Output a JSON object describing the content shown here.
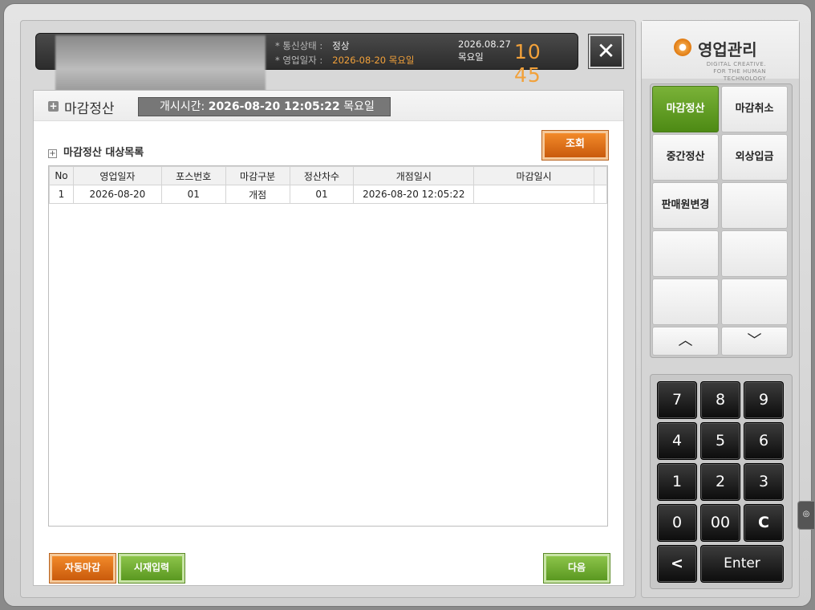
{
  "header": {
    "status_label_1": "* 통신상태 :",
    "status_value_1": "정상",
    "status_label_2": "* 영업일자 :",
    "status_value_2": "2026-08-20 목요일",
    "date": "2026.08.27",
    "weekday": "목요일",
    "clock_hour": "10",
    "clock_min": "45",
    "close_icon": "close-icon"
  },
  "page": {
    "title": "마감정산",
    "open_time_label": "개시시간:",
    "open_time_value": "2026-08-20 12:05:22",
    "open_time_day": "목요일",
    "section_title": "마감정산 대상목록",
    "query_button": "조회"
  },
  "table": {
    "columns": [
      "No",
      "영업일자",
      "포스번호",
      "마감구분",
      "정산차수",
      "개점일시",
      "마감일시"
    ],
    "rows": [
      [
        "1",
        "2026-08-20",
        "01",
        "개점",
        "01",
        "2026-08-20 12:05:22",
        ""
      ]
    ]
  },
  "footer": {
    "auto_close": "자동마감",
    "cash_input": "시재입력",
    "next": "다음"
  },
  "right": {
    "logo_text": "영업관리",
    "logo_sub_1": "DIGITAL CREATIVE.",
    "logo_sub_2": "FOR THE HUMAN TECHNOLOGY",
    "menu": [
      "마감정산",
      "마감취소",
      "중간정산",
      "외상입금",
      "판매원변경",
      "",
      "",
      "",
      "",
      ""
    ],
    "up_icon": "chevron-up-icon",
    "down_icon": "chevron-down-icon",
    "keys": [
      "7",
      "8",
      "9",
      "4",
      "5",
      "6",
      "1",
      "2",
      "3",
      "0",
      "00",
      "C"
    ],
    "back_key": "<",
    "enter_key": "Enter"
  },
  "colors": {
    "accent_orange": "#f2a13a",
    "active_green": "#5a9820",
    "button_orange": "#e0701a"
  }
}
